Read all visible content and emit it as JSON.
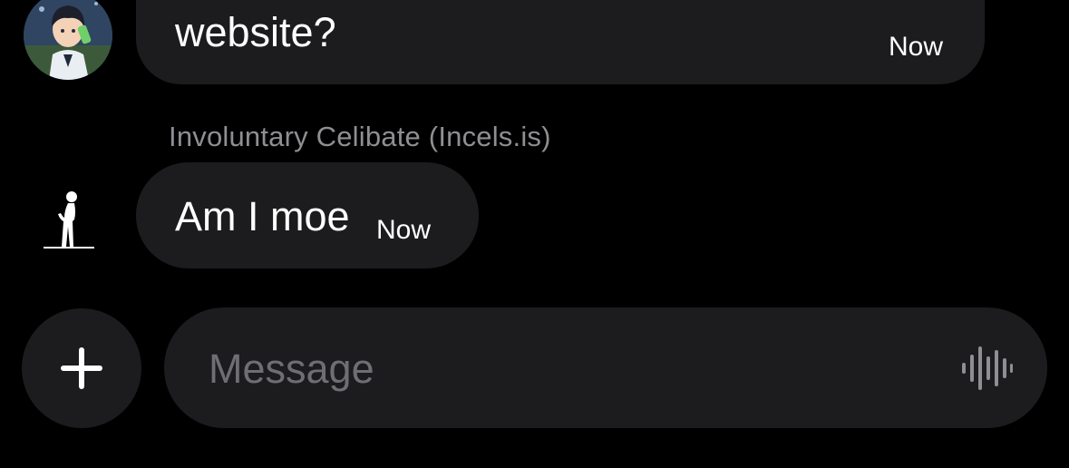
{
  "messages": [
    {
      "text": "website?",
      "time": "Now",
      "avatar_icon": "anime-character-avatar"
    },
    {
      "sender": "Involuntary Celibate (Incels.is)",
      "text": "Am I moe",
      "time": "Now",
      "avatar_icon": "standing-figure-icon"
    }
  ],
  "composer": {
    "placeholder": "Message",
    "add_icon": "plus-icon",
    "voice_icon": "waveform-icon"
  },
  "colors": {
    "background": "#000000",
    "bubble": "#1c1c1e",
    "text": "#ffffff",
    "secondary_text": "#8e8e93",
    "placeholder": "#6e6e73"
  }
}
